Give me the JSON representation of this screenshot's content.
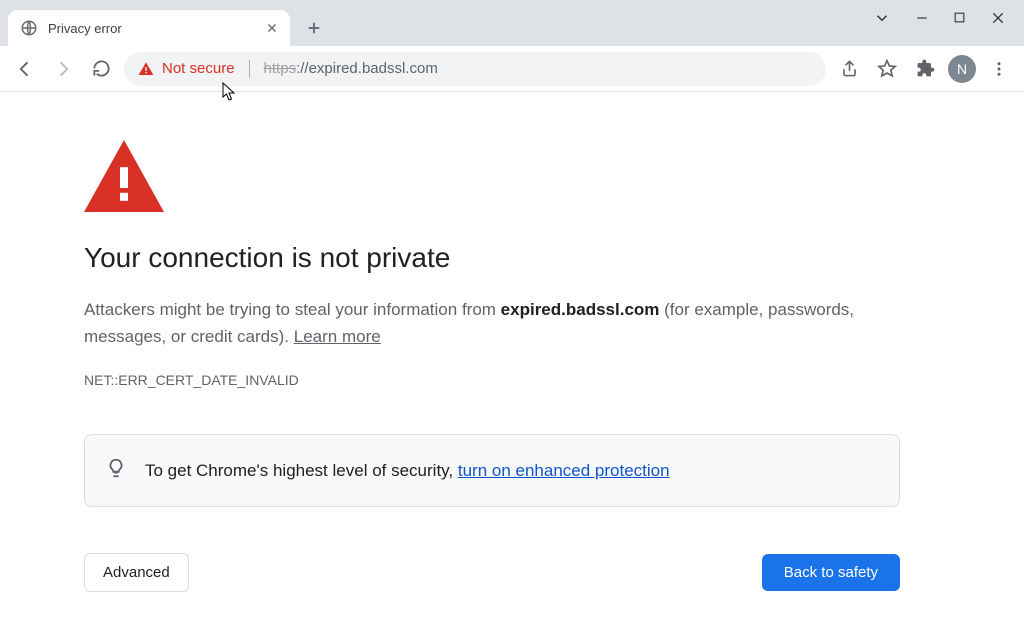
{
  "chrome": {
    "tab": {
      "title": "Privacy error"
    },
    "omnibox": {
      "security_label": "Not secure",
      "url_protocol": "https",
      "url_rest": "://expired.badssl.com"
    },
    "avatar_letter": "N"
  },
  "page": {
    "headline": "Your connection is not private",
    "body_prefix": "Attackers might be trying to steal your information from ",
    "body_domain": "expired.badssl.com",
    "body_suffix": " (for example, passwords, messages, or credit cards). ",
    "learn_more": "Learn more",
    "error_code": "NET::ERR_CERT_DATE_INVALID",
    "info_prefix": "To get Chrome's highest level of security, ",
    "info_link": "turn on enhanced protection",
    "buttons": {
      "advanced": "Advanced",
      "back": "Back to safety"
    }
  }
}
